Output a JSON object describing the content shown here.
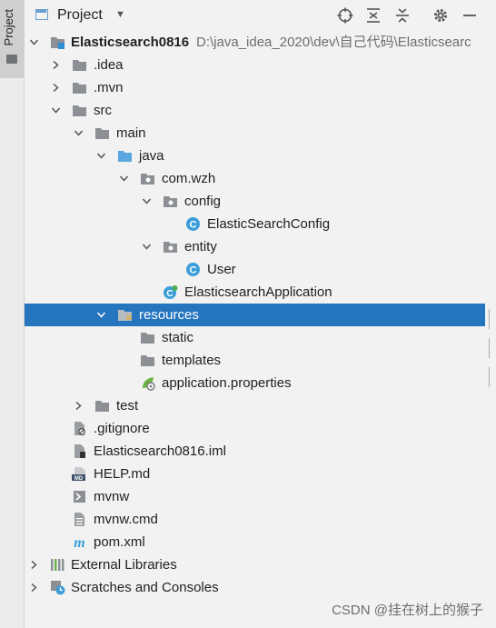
{
  "sidebar": {
    "tab_label": "Project"
  },
  "header": {
    "title": "Project"
  },
  "tree": {
    "root_name": "Elasticsearch0816",
    "root_path": "D:\\java_idea_2020\\dev\\自己代码\\Elasticsearc",
    "idea": ".idea",
    "mvn": ".mvn",
    "src": "src",
    "main": "main",
    "java": "java",
    "package": "com.wzh",
    "config": "config",
    "config_class": "ElasticSearchConfig",
    "entity": "entity",
    "entity_class": "User",
    "app_class": "ElasticsearchApplication",
    "resources": "resources",
    "static": "static",
    "templates": "templates",
    "app_props": "application.properties",
    "test": "test",
    "gitignore": ".gitignore",
    "iml": "Elasticsearch0816.iml",
    "help": "HELP.md",
    "mvnw": "mvnw",
    "mvnw_cmd": "mvnw.cmd",
    "pom": "pom.xml",
    "ext_libs": "External Libraries",
    "scratches": "Scratches and Consoles"
  },
  "watermark": "CSDN @挂在树上的猴子",
  "colors": {
    "selection": "#2675bf",
    "folder": "#8c9095",
    "source_folder": "#5aa7e0",
    "class_icon": "#3b9ed8"
  }
}
